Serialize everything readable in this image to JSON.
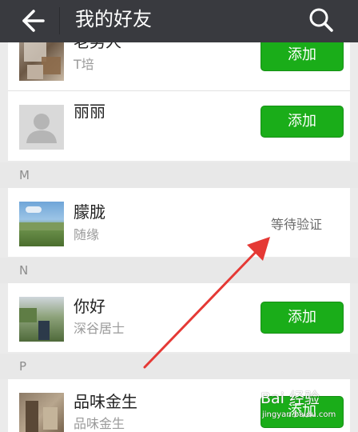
{
  "header": {
    "title": "我的好友",
    "back_icon": "arrow-left-icon",
    "search_icon": "search-icon"
  },
  "friends": [
    {
      "name": "老男人",
      "subtitle": "T培",
      "action": "添加"
    },
    {
      "name": "丽丽",
      "subtitle": "",
      "action": "添加"
    },
    {
      "name": "朦胧",
      "subtitle": "随缘",
      "status": "等待验证"
    },
    {
      "name": "你好",
      "subtitle": "深谷居士",
      "action": "添加"
    },
    {
      "name": "品味金生",
      "subtitle": "品味金生",
      "action": "添加"
    }
  ],
  "sections": [
    "M",
    "N",
    "P"
  ],
  "annotation": {
    "arrow_color": "#e53935"
  },
  "watermark": {
    "text": "Bai 经验",
    "url": "jingyan.baidu.com"
  },
  "colors": {
    "topbar": "#393a3f",
    "add_button": "#1aad19",
    "background": "#ebebeb"
  }
}
